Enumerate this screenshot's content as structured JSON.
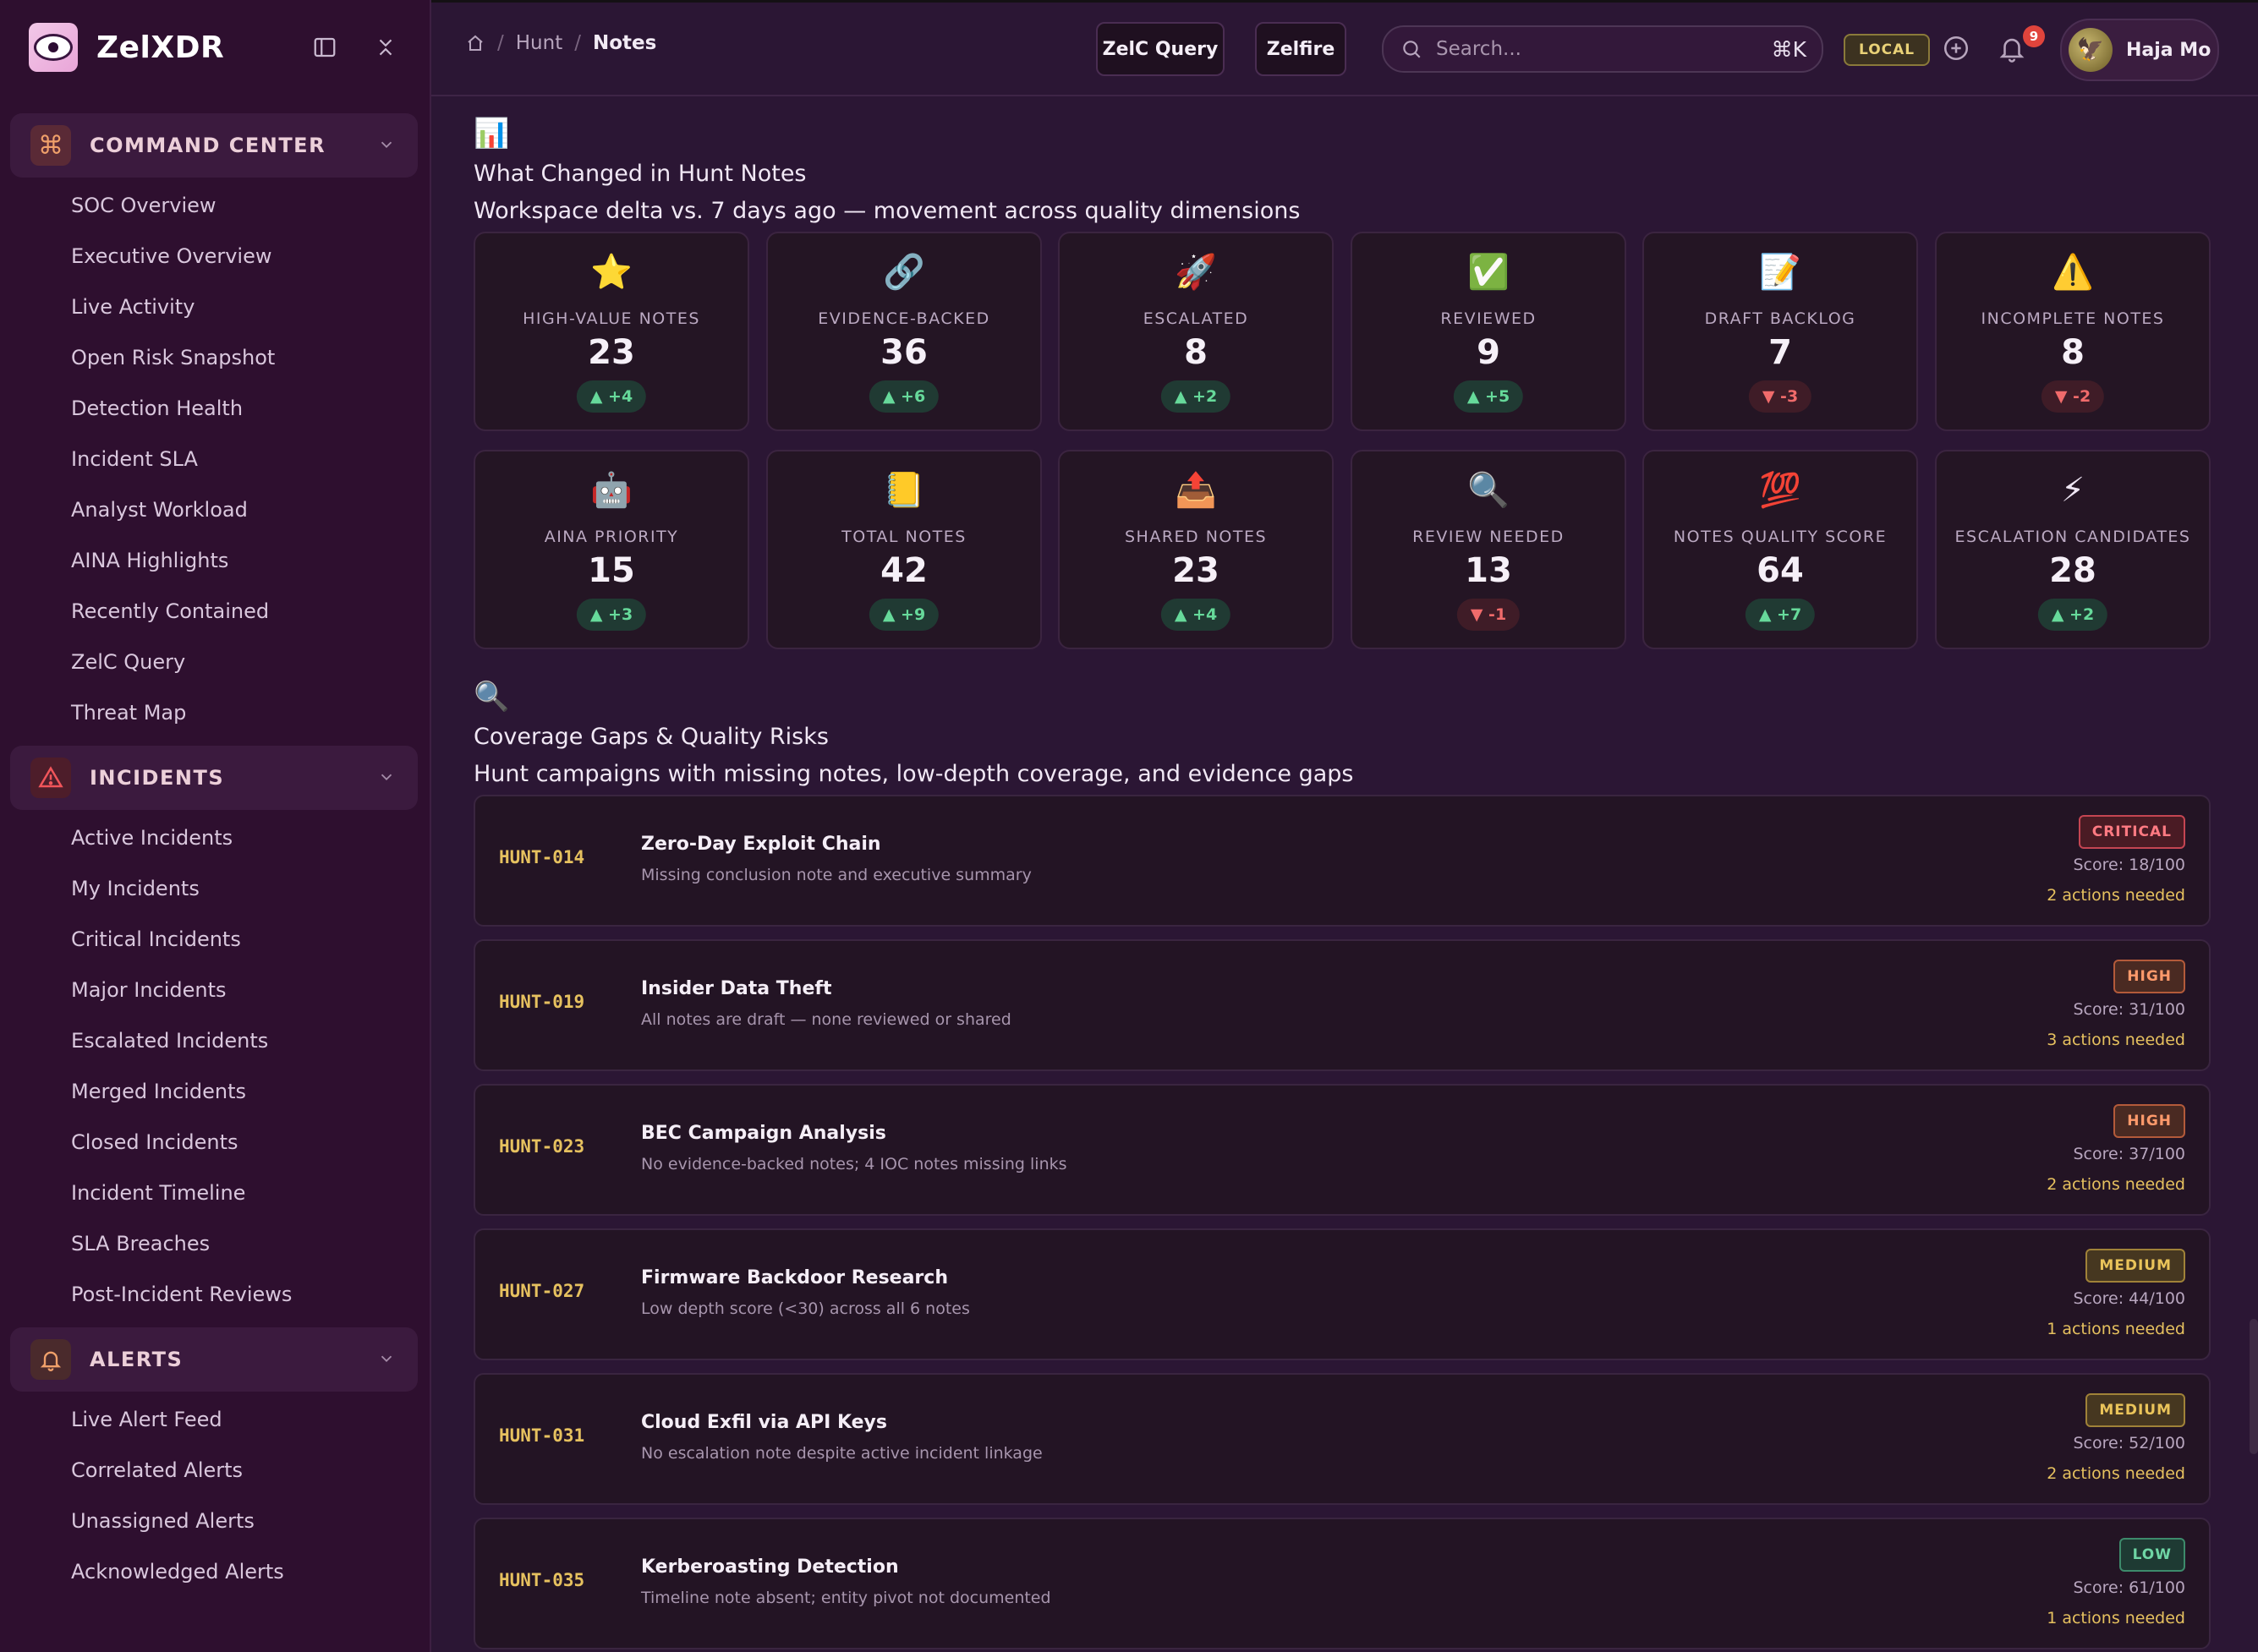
{
  "app": {
    "name": "ZelXDR"
  },
  "sidebar": {
    "sections": [
      {
        "label": "COMMAND CENTER",
        "items": [
          "SOC Overview",
          "Executive Overview",
          "Live Activity",
          "Open Risk Snapshot",
          "Detection Health",
          "Incident SLA",
          "Analyst Workload",
          "AINA Highlights",
          "Recently Contained",
          "ZelC Query",
          "Threat Map"
        ]
      },
      {
        "label": "INCIDENTS",
        "items": [
          "Active Incidents",
          "My Incidents",
          "Critical Incidents",
          "Major Incidents",
          "Escalated Incidents",
          "Merged Incidents",
          "Closed Incidents",
          "Incident Timeline",
          "SLA Breaches",
          "Post-Incident Reviews"
        ]
      },
      {
        "label": "ALERTS",
        "items": [
          "Live Alert Feed",
          "Correlated Alerts",
          "Unassigned Alerts",
          "Acknowledged Alerts"
        ]
      }
    ]
  },
  "topbar": {
    "breadcrumb": [
      "Hunt",
      "Notes"
    ],
    "zelc_query_label": "ZelC Query",
    "zelfire_label": "Zelfire",
    "search_placeholder": "Search...",
    "search_shortcut": "⌘K",
    "env_badge": "LOCAL",
    "notification_count": "9",
    "user_name": "Haja Mo"
  },
  "changes": {
    "title": "What Changed in Hunt Notes",
    "subtitle": "Workspace delta vs. 7 days ago — movement across quality dimensions",
    "cards": [
      {
        "icon": "⭐",
        "label": "HIGH-VALUE NOTES",
        "value": "23",
        "delta": "▲ +4",
        "dir": "up"
      },
      {
        "icon": "🔗",
        "label": "EVIDENCE-BACKED",
        "value": "36",
        "delta": "▲ +6",
        "dir": "up"
      },
      {
        "icon": "🚀",
        "label": "ESCALATED",
        "value": "8",
        "delta": "▲ +2",
        "dir": "up"
      },
      {
        "icon": "✅",
        "label": "REVIEWED",
        "value": "9",
        "delta": "▲ +5",
        "dir": "up"
      },
      {
        "icon": "📝",
        "label": "DRAFT BACKLOG",
        "value": "7",
        "delta": "▼ -3",
        "dir": "down"
      },
      {
        "icon": "⚠️",
        "label": "INCOMPLETE NOTES",
        "value": "8",
        "delta": "▼ -2",
        "dir": "down"
      },
      {
        "icon": "🤖",
        "label": "AINA PRIORITY",
        "value": "15",
        "delta": "▲ +3",
        "dir": "up"
      },
      {
        "icon": "📒",
        "label": "TOTAL NOTES",
        "value": "42",
        "delta": "▲ +9",
        "dir": "up"
      },
      {
        "icon": "📤",
        "label": "SHARED NOTES",
        "value": "23",
        "delta": "▲ +4",
        "dir": "up"
      },
      {
        "icon": "🔍",
        "label": "REVIEW NEEDED",
        "value": "13",
        "delta": "▼ -1",
        "dir": "down"
      },
      {
        "icon": "💯",
        "label": "NOTES QUALITY SCORE",
        "value": "64",
        "delta": "▲ +7",
        "dir": "up"
      },
      {
        "icon": "⚡",
        "label": "ESCALATION CANDIDATES",
        "value": "28",
        "delta": "▲ +2",
        "dir": "up"
      }
    ]
  },
  "gaps": {
    "title": "Coverage Gaps & Quality Risks",
    "subtitle": "Hunt campaigns with missing notes, low-depth coverage, and evidence gaps",
    "rows": [
      {
        "id": "HUNT-014",
        "title": "Zero-Day Exploit Chain",
        "desc": "Missing conclusion note and executive summary",
        "severity": "CRITICAL",
        "sev_class": "critical",
        "score": "Score: 18/100",
        "actions": "2 actions needed"
      },
      {
        "id": "HUNT-019",
        "title": "Insider Data Theft",
        "desc": "All notes are draft — none reviewed or shared",
        "severity": "HIGH",
        "sev_class": "high",
        "score": "Score: 31/100",
        "actions": "3 actions needed"
      },
      {
        "id": "HUNT-023",
        "title": "BEC Campaign Analysis",
        "desc": "No evidence-backed notes; 4 IOC notes missing links",
        "severity": "HIGH",
        "sev_class": "high",
        "score": "Score: 37/100",
        "actions": "2 actions needed"
      },
      {
        "id": "HUNT-027",
        "title": "Firmware Backdoor Research",
        "desc": "Low depth score (<30) across all 6 notes",
        "severity": "MEDIUM",
        "sev_class": "medium",
        "score": "Score: 44/100",
        "actions": "1 actions needed"
      },
      {
        "id": "HUNT-031",
        "title": "Cloud Exfil via API Keys",
        "desc": "No escalation note despite active incident linkage",
        "severity": "MEDIUM",
        "sev_class": "medium",
        "score": "Score: 52/100",
        "actions": "2 actions needed"
      },
      {
        "id": "HUNT-035",
        "title": "Kerberoasting Detection",
        "desc": "Timeline note absent; entity pivot not documented",
        "severity": "LOW",
        "sev_class": "low",
        "score": "Score: 61/100",
        "actions": "1 actions needed"
      }
    ]
  },
  "icons": {
    "changes_section": "📊",
    "gaps_section": "🔍"
  },
  "colors": {
    "accent_gold": "#e6c15f",
    "delta_up": "#66d99a",
    "delta_down": "#f06b6b",
    "critical": "#ff7a82"
  }
}
